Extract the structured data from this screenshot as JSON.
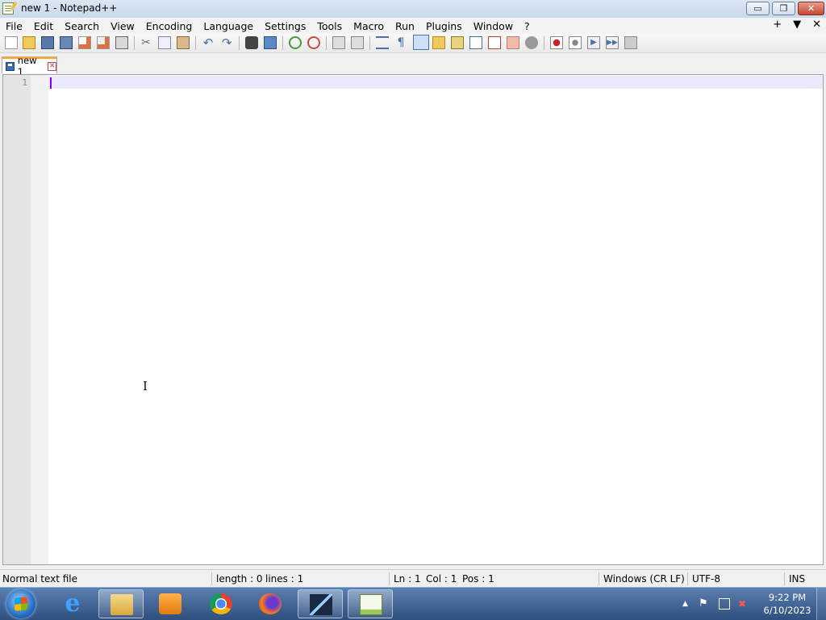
{
  "window": {
    "title": "new 1 - Notepad++"
  },
  "window_controls": {
    "minimize": "▭",
    "maximize": "❐",
    "close": "✕"
  },
  "menubar": {
    "items": [
      "File",
      "Edit",
      "Search",
      "View",
      "Encoding",
      "Language",
      "Settings",
      "Tools",
      "Macro",
      "Run",
      "Plugins",
      "Window",
      "?"
    ],
    "right": {
      "add": "+",
      "dropdown": "▼",
      "close": "✕"
    }
  },
  "toolbar": {
    "icons": [
      "new-file-icon",
      "open-file-icon",
      "save-icon",
      "save-all-icon",
      "close-icon",
      "close-all-icon",
      "print-icon",
      "cut-icon",
      "copy-icon",
      "paste-icon",
      "undo-icon",
      "redo-icon",
      "find-icon",
      "replace-icon",
      "zoom-in-icon",
      "zoom-out-icon",
      "sync-vertical-icon",
      "sync-horizontal-icon",
      "word-wrap-icon",
      "show-all-characters-icon",
      "indent-guide-icon",
      "user-defined-language-icon",
      "document-map-icon",
      "function-list-icon",
      "folder-as-workspace-icon",
      "monitoring-icon",
      "start-recording-icon",
      "stop-recording-icon",
      "playback-icon",
      "run-macro-multiple-icon",
      "save-macro-icon"
    ]
  },
  "tabs": [
    {
      "label": "new 1",
      "close": "✕"
    }
  ],
  "editor": {
    "line_numbers": [
      "1"
    ],
    "content": ""
  },
  "statusbar": {
    "file_type": "Normal text file",
    "length": "length : 0",
    "lines": "lines : 1",
    "ln": "Ln : 1",
    "col": "Col : 1",
    "pos": "Pos : 1",
    "eol": "Windows (CR LF)",
    "encoding": "UTF-8",
    "mode": "INS"
  },
  "taskbar": {
    "apps": [
      "internet-explorer-icon",
      "file-explorer-icon",
      "media-player-icon",
      "chrome-icon",
      "firefox-icon",
      "video-editor-icon",
      "notepad-plus-plus-icon"
    ],
    "time": "9:22 PM",
    "date": "6/10/2023"
  },
  "colors": {
    "tab_accent": "#f3a64a",
    "current_line": "#e8e8ff",
    "caret": "#8000ff",
    "taskbar": "#3d5f8f"
  }
}
